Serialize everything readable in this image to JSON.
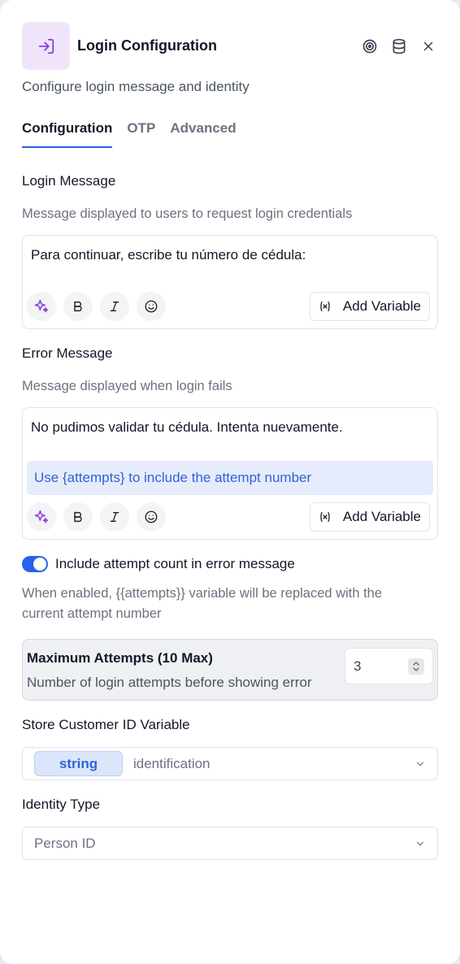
{
  "header": {
    "title": "Login Configuration",
    "subtitle": "Configure login message and identity",
    "icons": [
      "login-icon",
      "target-icon",
      "database-icon",
      "close-icon"
    ]
  },
  "tabs": [
    {
      "label": "Configuration",
      "active": true
    },
    {
      "label": "OTP",
      "active": false
    },
    {
      "label": "Advanced",
      "active": false
    }
  ],
  "login_message": {
    "label": "Login Message",
    "description": "Message displayed to users to request login credentials",
    "value": "Para continuar, escribe tu número de cédula:",
    "add_variable_label": "Add Variable"
  },
  "error_message": {
    "label": "Error Message",
    "description": "Message displayed when login fails",
    "value": "No pudimos validar tu cédula. Intenta nuevamente.",
    "hint": "Use {attempts} to include the attempt number",
    "add_variable_label": "Add Variable"
  },
  "include_attempt": {
    "label": "Include attempt count in error message",
    "enabled": true,
    "description_line1": "When enabled, {{attempts}} variable will be replaced with the",
    "description_line2": "current attempt number"
  },
  "max_attempts": {
    "title": "Maximum Attempts (10 Max)",
    "description": "Number of login attempts before showing error",
    "value": "3"
  },
  "customer_id": {
    "label": "Store Customer ID Variable",
    "type_chip": "string",
    "value": "identification"
  },
  "identity_type": {
    "label": "Identity Type",
    "value": "Person ID"
  },
  "colors": {
    "accent": "#2563eb",
    "header_icon_bg": "#f0e4fb",
    "header_icon": "#8b3fd8",
    "hint_bg": "#e6ecfb",
    "hint_text": "#2f63d6"
  }
}
